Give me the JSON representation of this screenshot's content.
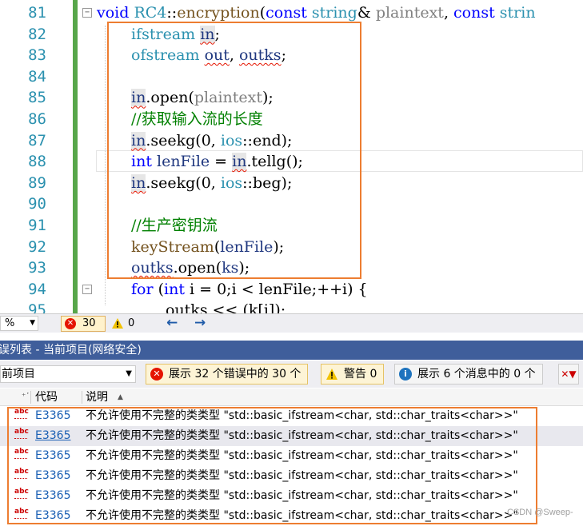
{
  "editor": {
    "line_numbers": [
      "81",
      "82",
      "83",
      "84",
      "85",
      "86",
      "87",
      "88",
      "89",
      "90",
      "91",
      "92",
      "93",
      "94",
      "95"
    ],
    "line81": {
      "kw1": "void",
      "cls": "RC4",
      "sep": "::",
      "fn": "encryption",
      "paren": "(",
      "kw2": "const",
      "ty": "string",
      "amp": "&",
      "param": "plaintext",
      "comma": ",",
      "kw3": "const",
      "ty2": "strin"
    },
    "line82": {
      "ty": "ifstream",
      "var": "in",
      "semi": ";"
    },
    "line83": {
      "ty": "ofstream",
      "var1": "out",
      "comma": ",",
      "var2": "outks",
      "semi": ";"
    },
    "line85": {
      "var": "in",
      "rest1": ".open(",
      "param": "plaintext",
      "rest2": ");"
    },
    "line86": {
      "comment": "//获取输入流的长度"
    },
    "line87": {
      "var": "in",
      "rest1": ".seekg(0, ",
      "ty": "ios",
      "rest2": "::end);"
    },
    "line88": {
      "kw": "int",
      "var": "lenFile",
      "eq": " = ",
      "var2": "in",
      "rest": ".tellg();"
    },
    "line89": {
      "var": "in",
      "rest1": ".seekg(0, ",
      "ty": "ios",
      "rest2": "::beg);"
    },
    "line91": {
      "comment": "//生产密钥流"
    },
    "line92": {
      "fn": "keyStream",
      "open": "(",
      "var": "lenFile",
      "close": ");"
    },
    "line93": {
      "var": "outks",
      "rest1": ".open(",
      "var2": "ks",
      "rest2": ");"
    },
    "line94": {
      "kw": "for",
      "open": " (",
      "kw2": "int",
      "rest": " i = 0;i < lenFile;++i) {"
    },
    "line95": {
      "text": "outks << (k[i]);"
    }
  },
  "status": {
    "zoom": "%",
    "error_count": "30",
    "warning_count": "0",
    "back_arrow": "←",
    "forward_arrow": "→"
  },
  "errlist": {
    "title": "误列表 - 当前项目(网络安全)",
    "scope": "前项目",
    "errors_filter": "展示 32 个错误中的 30 个",
    "warnings_filter": "警告 0",
    "messages_filter": "展示 6 个消息中的 0 个",
    "headers": {
      "code": "代码",
      "desc": "说明",
      "sort": "▲"
    },
    "rows": [
      {
        "code": "E3365",
        "desc": "不允许使用不完整的类类型 \"std::basic_ifstream<char, std::char_traits<char>>\""
      },
      {
        "code": "E3365",
        "desc": "不允许使用不完整的类类型 \"std::basic_ifstream<char, std::char_traits<char>>\""
      },
      {
        "code": "E3365",
        "desc": "不允许使用不完整的类类型 \"std::basic_ifstream<char, std::char_traits<char>>\""
      },
      {
        "code": "E3365",
        "desc": "不允许使用不完整的类类型 \"std::basic_ifstream<char, std::char_traits<char>>\""
      },
      {
        "code": "E3365",
        "desc": "不允许使用不完整的类类型 \"std::basic_ifstream<char, std::char_traits<char>>\""
      },
      {
        "code": "E3365",
        "desc": "不允许使用不完整的类类型 \"std::basic_ifstream<char, std::char_traits<char>>\""
      }
    ],
    "abc_icon": "abc"
  },
  "watermark": "CSDN @Sweep-"
}
